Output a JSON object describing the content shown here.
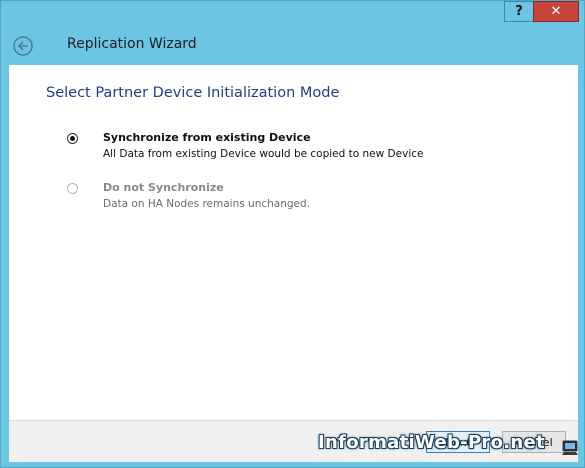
{
  "window": {
    "title": "Replication Wizard",
    "help_label": "?",
    "close_label": "✕"
  },
  "page": {
    "heading": "Select Partner Device Initialization Mode"
  },
  "options": [
    {
      "title": "Synchronize from existing Device",
      "description": "All Data from existing Device would be copied to new Device",
      "selected": true,
      "enabled": true
    },
    {
      "title": "Do not Synchronize",
      "description": "Data on HA Nodes remains unchanged.",
      "selected": false,
      "enabled": false
    }
  ],
  "footer": {
    "next_label": "Next",
    "cancel_label": "Cancel"
  },
  "watermark": {
    "text": "InformatiWeb-Pro.net"
  },
  "colors": {
    "chrome": "#6bc5e3",
    "heading": "#1f3d8a",
    "close": "#c7463b"
  },
  "icons": {
    "back": "back-arrow-icon",
    "watermark": "monitor-icon"
  }
}
